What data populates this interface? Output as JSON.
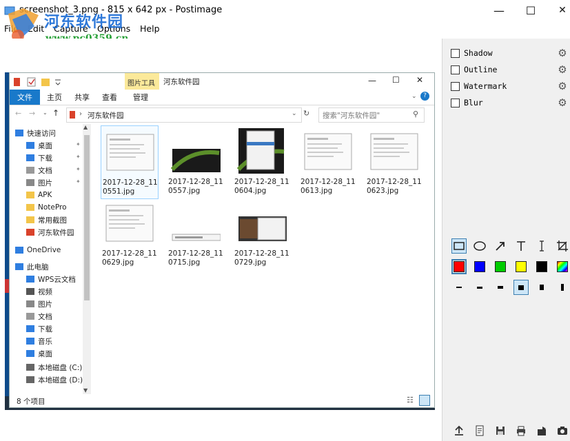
{
  "window": {
    "title": "screenshot_3.png - 815 x 642 px - Postimage",
    "minimize_glyph": "—",
    "maximize_glyph": "☐",
    "close_glyph": "✕"
  },
  "menu": [
    "File",
    "Edit",
    "Capture",
    "Options",
    "Help"
  ],
  "watermark": {
    "line1": "河东软件园",
    "line2": "www.pc0359.cn"
  },
  "effects": [
    {
      "label": "Shadow",
      "checked": false
    },
    {
      "label": "Outline",
      "checked": false
    },
    {
      "label": "Watermark",
      "checked": false
    },
    {
      "label": "Blur",
      "checked": false
    }
  ],
  "tools": [
    "rectangle-tool",
    "ellipse-tool",
    "arrow-tool",
    "text-tool",
    "cursor-text-tool",
    "crop-tool"
  ],
  "colors": [
    "#ff0000",
    "#0000ff",
    "#00cc00",
    "#ffff00",
    "#000000",
    "gradient"
  ],
  "bottom_icons": [
    "upload-icon",
    "document-icon",
    "save-icon",
    "print-icon",
    "share-icon",
    "camera-icon"
  ],
  "explorer": {
    "ribbon_tabs": [
      "文件",
      "主页",
      "共享",
      "查看",
      "管理"
    ],
    "tools_group": "图片工具",
    "window_title": "河东软件园",
    "address": "河东软件园",
    "search_placeholder": "搜索\"河东软件园\"",
    "nav_items": [
      {
        "label": "快速访问",
        "pin": false
      },
      {
        "label": "桌面",
        "pin": true
      },
      {
        "label": "下载",
        "pin": true
      },
      {
        "label": "文档",
        "pin": true
      },
      {
        "label": "图片",
        "pin": true
      },
      {
        "label": "APK",
        "pin": false
      },
      {
        "label": "NotePro",
        "pin": false
      },
      {
        "label": "常用截图",
        "pin": false
      },
      {
        "label": "河东软件园",
        "pin": false
      },
      {
        "label": "OneDrive",
        "pin": false
      },
      {
        "label": "此电脑",
        "pin": false
      },
      {
        "label": "WPS云文档",
        "pin": false
      },
      {
        "label": "视频",
        "pin": false
      },
      {
        "label": "图片",
        "pin": false
      },
      {
        "label": "文档",
        "pin": false
      },
      {
        "label": "下载",
        "pin": false
      },
      {
        "label": "音乐",
        "pin": false
      },
      {
        "label": "桌面",
        "pin": false
      },
      {
        "label": "本地磁盘 (C:)",
        "pin": false
      },
      {
        "label": "本地磁盘 (D:)",
        "pin": false
      }
    ],
    "files": [
      "2017-12-28_110551.jpg",
      "2017-12-28_110557.jpg",
      "2017-12-28_110604.jpg",
      "2017-12-28_110613.jpg",
      "2017-12-28_110623.jpg",
      "2017-12-28_110629.jpg",
      "2017-12-28_110715.jpg",
      "2017-12-28_110729.jpg"
    ],
    "status": "8 个项目"
  }
}
